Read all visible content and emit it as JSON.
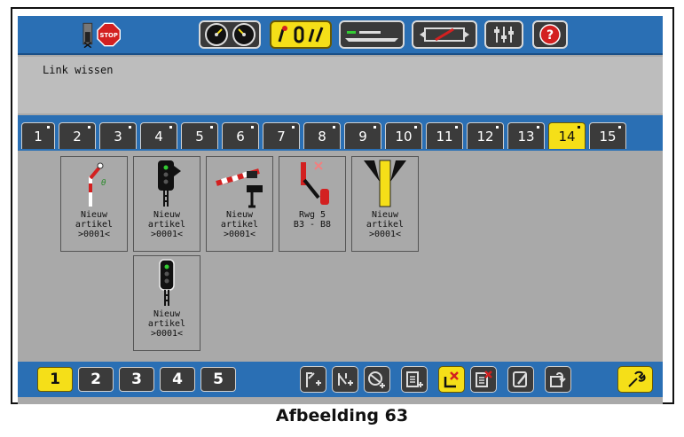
{
  "message": "Link wissen",
  "topbar": {
    "icons": [
      "stop-icon",
      "speedometer-icon",
      "keyboard-icon",
      "track-layout-icon",
      "locomotive-icon",
      "settings-sliders-icon",
      "help-icon"
    ],
    "stop_label": "STOP",
    "help_label": "?"
  },
  "tabs": [
    "1",
    "2",
    "3",
    "4",
    "5",
    "6",
    "7",
    "8",
    "9",
    "10",
    "11",
    "12",
    "13",
    "14",
    "15"
  ],
  "active_tab": "14",
  "articles": [
    {
      "icon": "semaphore-signal-icon",
      "line1": "Nieuw",
      "line2": "artikel",
      "line3": ">0001<"
    },
    {
      "icon": "light-signal-icon",
      "line1": "Nieuw",
      "line2": "artikel",
      "line3": ">0001<"
    },
    {
      "icon": "level-crossing-icon",
      "line1": "Nieuw",
      "line2": "artikel",
      "line3": ">0001<"
    },
    {
      "icon": "route-icon",
      "line1": "Rwg 5",
      "line2": "B3 - B8",
      "line3": ""
    },
    {
      "icon": "turnout-icon",
      "line1": "Nieuw",
      "line2": "artikel",
      "line3": ">0001<"
    },
    {
      "icon": "light-signal-small-icon",
      "line1": "Nieuw",
      "line2": "artikel",
      "line3": ">0001<"
    }
  ],
  "pages": [
    "1",
    "2",
    "3",
    "4",
    "5"
  ],
  "active_page": "1",
  "actions": [
    "add-signal-icon",
    "add-switch-icon",
    "add-route-icon",
    "add-list-icon",
    "delete-link-icon",
    "delete-article-icon",
    "edit-icon",
    "export-icon",
    "wrench-icon"
  ],
  "colors": {
    "accent_yellow": "#f5df18",
    "bar_blue": "#2a6fb4",
    "panel_gray": "#a9a9a9",
    "stop_red": "#d32020"
  },
  "caption": "Afbeelding 63"
}
